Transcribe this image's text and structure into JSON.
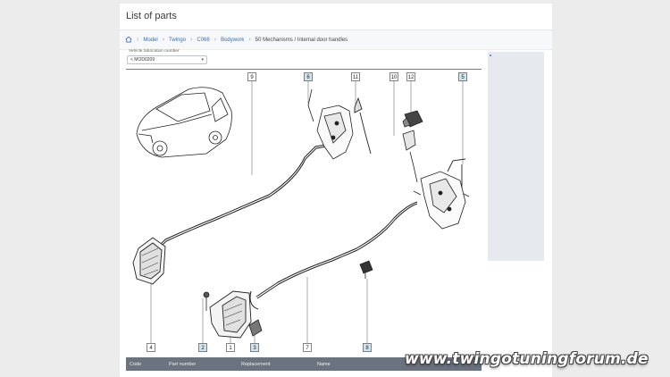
{
  "header": {
    "title": "List of parts"
  },
  "breadcrumb": {
    "home_icon": "home-icon",
    "items": [
      "Model",
      "Twingo",
      "C068",
      "Bodywork"
    ],
    "current": "50 Mechanisms / Internal door handles"
  },
  "filter": {
    "label": "Vehicle fabrication number",
    "value": "< MOD0209",
    "icon": "chevron-down-icon"
  },
  "diagram": {
    "callouts": [
      "9",
      "6",
      "11",
      "10",
      "12",
      "5",
      "4",
      "2",
      "1",
      "3",
      "7",
      "8"
    ],
    "highlighted": [
      "6",
      "5",
      "2",
      "3",
      "8"
    ]
  },
  "table": {
    "columns": [
      "Code",
      "Part number",
      "Replacement",
      "Name"
    ]
  },
  "watermark": "www.twingotuningforum.de",
  "colors": {
    "accent_rule": "#d9534f",
    "link": "#2f6fb6",
    "table_header": "#6b7280",
    "highlight": "#cfe6f0"
  }
}
